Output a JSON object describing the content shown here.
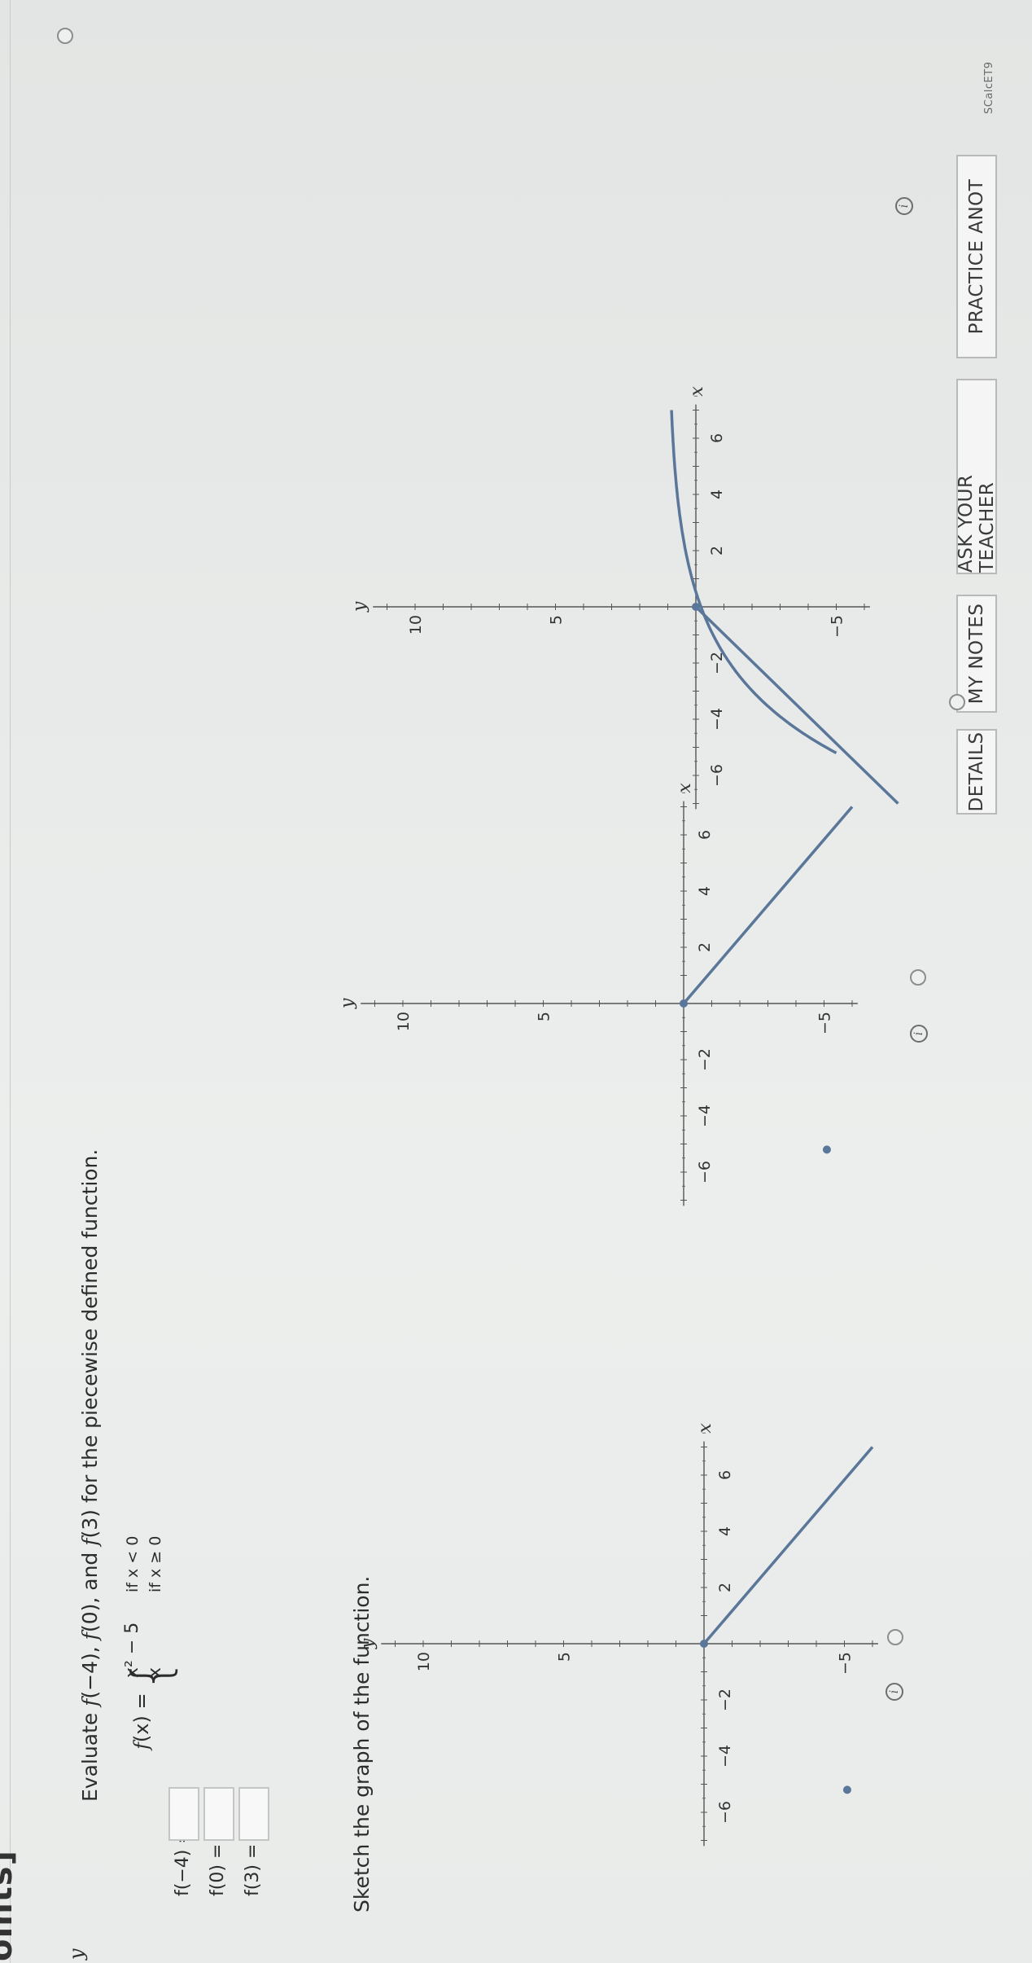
{
  "header": {
    "title_fragment": "oints]"
  },
  "toolbar": {
    "details": "DETAILS",
    "my_notes": "MY NOTES",
    "ask_teacher": "ASK YOUR TEACHER",
    "practice": "PRACTICE ANOT"
  },
  "question_code": "SCalcET9",
  "question": {
    "prompt_pre": "Evaluate ",
    "prompt_f1": "f",
    "prompt_a1": "(−4), ",
    "prompt_f2": "f",
    "prompt_a2": "(0), and ",
    "prompt_f3": "f",
    "prompt_a3": "(3) for the piecewise defined function.",
    "function_lhs_f": "f",
    "function_lhs": "(x) =",
    "piece1_expr": "x² − 5",
    "piece1_cond": "if x < 0",
    "piece2_expr": "x",
    "piece2_cond": "if x ≥ 0"
  },
  "answers": [
    {
      "label": "f(−4) =",
      "value": ""
    },
    {
      "label": "f(0) =",
      "value": ""
    },
    {
      "label": "f(3) =",
      "value": ""
    }
  ],
  "sketch_prompt": "Sketch the graph of the function.",
  "graph_axes": {
    "x_label": "x",
    "y_label": "y",
    "x_ticks": [
      "−6",
      "−4",
      "−2",
      "2",
      "4",
      "6"
    ],
    "y_ticks": [
      "10",
      "5",
      "−5"
    ]
  },
  "graph_options_labels": {
    "bottom_y_label": "y"
  },
  "colors": {
    "curve": "#5a7699",
    "axis": "#555555",
    "background": "#e9ebea"
  },
  "icons": {
    "info": "info-icon",
    "radio": "radio-icon"
  }
}
